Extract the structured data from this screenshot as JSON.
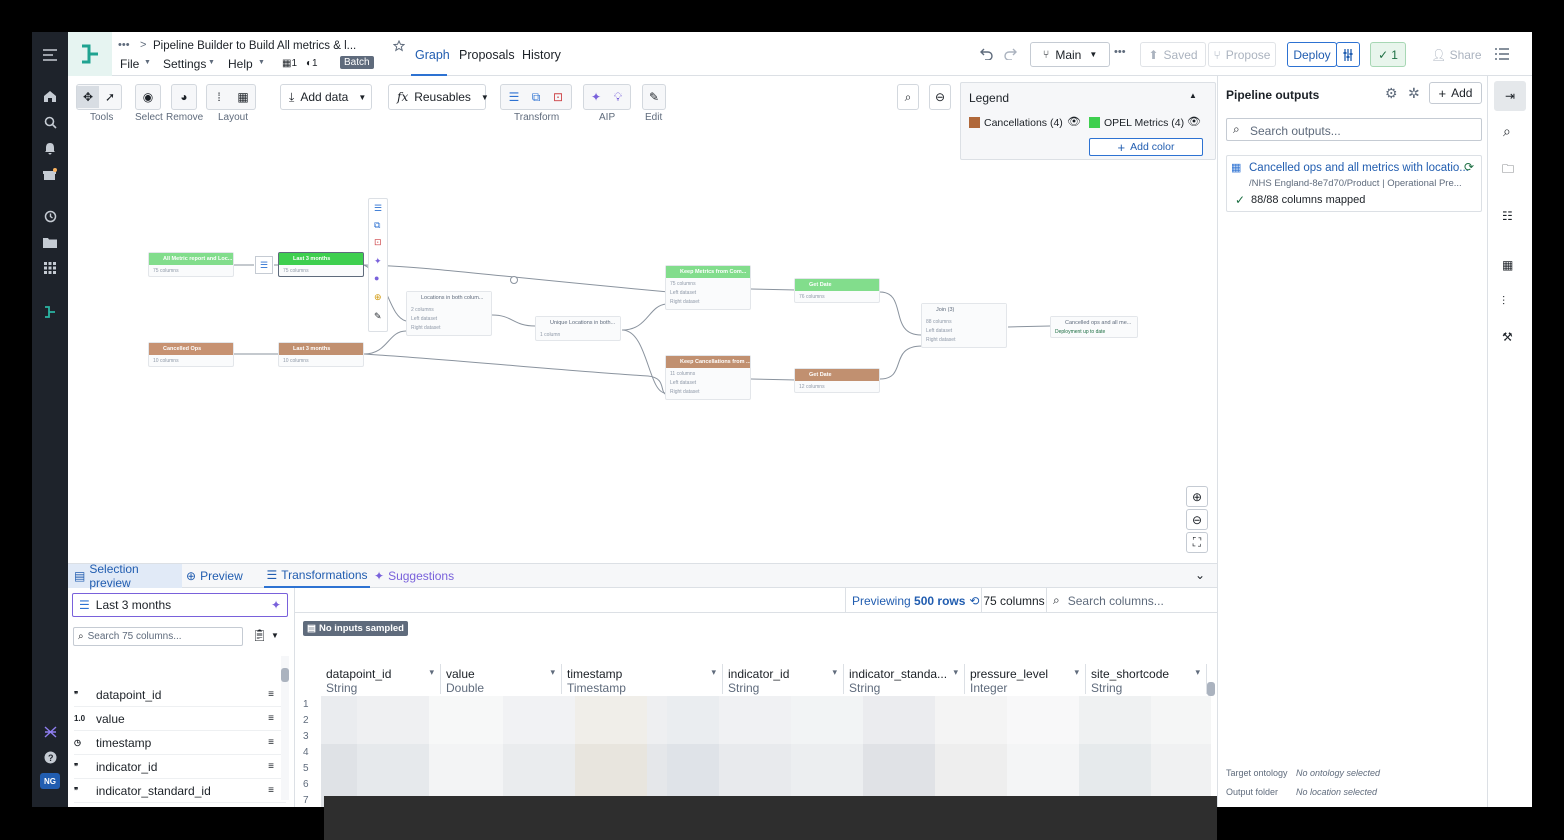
{
  "header": {
    "breadcrumb_dots": "•••",
    "breadcrumb_sep": ">",
    "title": "Pipeline Builder to Build All metrics & l...",
    "menus": [
      "File",
      "Settings",
      "Help"
    ],
    "counts": {
      "a": "1",
      "b": "1"
    },
    "batch": "Batch",
    "tabs": [
      "Graph",
      "Proposals",
      "History"
    ],
    "branch": "Main",
    "more": "•••",
    "saved": "Saved",
    "propose": "Propose",
    "deploy": "Deploy",
    "checks": "1",
    "share": "Share"
  },
  "toolbar": {
    "tools_label": "Tools",
    "select_label": "Select",
    "remove_label": "Remove",
    "layout_label": "Layout",
    "add_data": "Add data",
    "reusables": "Reusables",
    "fx": "fx",
    "transform_label": "Transform",
    "aip_label": "AIP",
    "edit_label": "Edit"
  },
  "legend": {
    "title": "Legend",
    "items": [
      {
        "label": "Cancellations",
        "count": "(4)",
        "color": "#b0683a"
      },
      {
        "label": "OPEL Metrics",
        "count": "(4)",
        "color": "#3ecf4f"
      }
    ],
    "add_color": "Add color"
  },
  "nodes": {
    "n1": {
      "title": "All Metric report and Loc...",
      "sub": "75 columns"
    },
    "n2": {
      "title": "Last 3 months",
      "sub": "75 columns"
    },
    "n3": {
      "title": "Cancelled Ops",
      "sub": "10 columns"
    },
    "n4": {
      "title": "Last 3 months",
      "sub": "10 columns"
    },
    "n5": {
      "title": "Locations in both colum...",
      "sub": "2 columns",
      "l": "Left dataset",
      "r": "Right dataset"
    },
    "n6": {
      "title": "Unique Locations in both...",
      "sub": "1 column"
    },
    "n7": {
      "title": "Keep Metrics from Com...",
      "sub": "75 columns",
      "l": "Left dataset",
      "r": "Right dataset"
    },
    "n8": {
      "title": "Keep Cancellations from ...",
      "sub": "11 columns",
      "l": "Left dataset",
      "r": "Right dataset"
    },
    "n9": {
      "title": "Get Date",
      "sub": "76 columns"
    },
    "n10": {
      "title": "Get Date",
      "sub": "12 columns"
    },
    "n11": {
      "title": "Join (3)",
      "sub": "88 columns",
      "l": "Left dataset",
      "r": "Right dataset"
    },
    "n12": {
      "title": "Cancelled ops and all me...",
      "sub": "Deployment up to date"
    }
  },
  "outputs": {
    "title": "Pipeline outputs",
    "add": "Add",
    "search_placeholder": "Search outputs...",
    "item_title": "Cancelled ops and all metrics with locatio...",
    "item_path": "/NHS England-8e7d70/Product | Operational Pre...",
    "item_mapped": "88/88 columns mapped",
    "target_ontology_label": "Target ontology",
    "target_ontology_value": "No ontology selected",
    "output_folder_label": "Output folder",
    "output_folder_value": "No location selected"
  },
  "bottom": {
    "tabs": [
      "Selection preview",
      "Preview",
      "Transformations",
      "Suggestions"
    ],
    "selected_node": "Last 3 months",
    "search_placeholder": "Search 75 columns...",
    "columns": [
      {
        "icon": "99",
        "name": "datapoint_id"
      },
      {
        "icon": "1.0",
        "name": "value"
      },
      {
        "icon": "clock",
        "name": "timestamp"
      },
      {
        "icon": "99",
        "name": "indicator_id"
      },
      {
        "icon": "99",
        "name": "indicator_standard_id"
      },
      {
        "icon": "123",
        "name": "pressure_level"
      }
    ],
    "previewing": "Previewing",
    "rows": "500 rows",
    "col_count": "75 columns",
    "search_columns": "Search columns...",
    "no_inputs": "No inputs sampled",
    "table_headers": [
      {
        "name": "datapoint_id",
        "type": "String"
      },
      {
        "name": "value",
        "type": "Double"
      },
      {
        "name": "timestamp",
        "type": "Timestamp"
      },
      {
        "name": "indicator_id",
        "type": "String"
      },
      {
        "name": "indicator_standa...",
        "type": "String"
      },
      {
        "name": "pressure_level",
        "type": "Integer"
      },
      {
        "name": "site_shortcode",
        "type": "String"
      }
    ],
    "row_numbers": [
      "1",
      "2",
      "3",
      "4",
      "5",
      "6",
      "7"
    ]
  },
  "rail_badge": "NG"
}
